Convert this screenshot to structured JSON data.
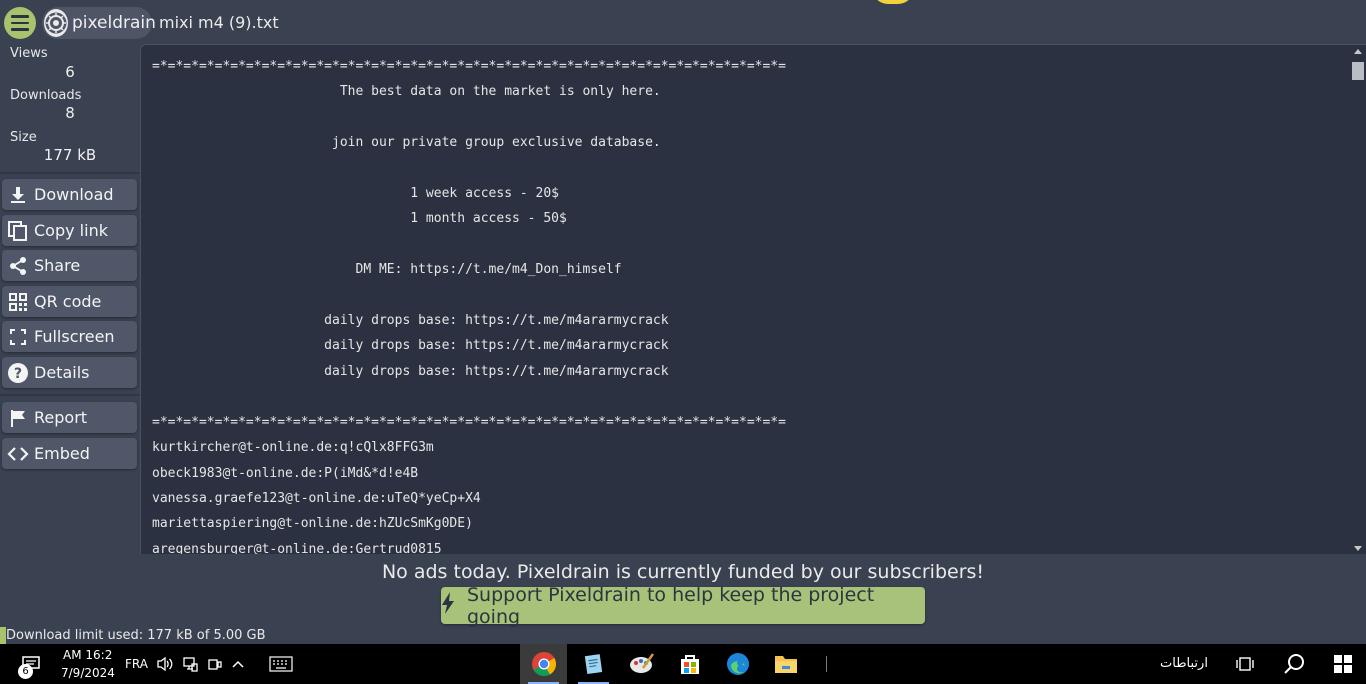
{
  "header": {
    "brand": "pixeldrain",
    "file_name": "mixi m4 (9).txt"
  },
  "stats": {
    "views_label": "Views",
    "views_value": "6",
    "downloads_label": "Downloads",
    "downloads_value": "8",
    "size_label": "Size",
    "size_value": "177 kB"
  },
  "sidebar": {
    "download": "Download",
    "copy_link": "Copy link",
    "share": "Share",
    "qr_code": "QR code",
    "fullscreen": "Fullscreen",
    "details": "Details",
    "report": "Report",
    "embed": "Embed"
  },
  "file_content": "=*=*=*=*=*=*=*=*=*=*=*=*=*=*=*=*=*=*=*=*=*=*=*=*=*=*=*=*=*=*=*=*=*=*=*=*=*=*=*=*=\n                        The best data on the market is only here.\n\n                       join our private group exclusive database.\n\n                                 1 week access - 20$\n                                 1 month access - 50$\n\n                          DM ME: https://t.me/m4_Don_himself\n\n                      daily drops base: https://t.me/m4ararmycrack\n                      daily drops base: https://t.me/m4ararmycrack\n                      daily drops base: https://t.me/m4ararmycrack\n\n=*=*=*=*=*=*=*=*=*=*=*=*=*=*=*=*=*=*=*=*=*=*=*=*=*=*=*=*=*=*=*=*=*=*=*=*=*=*=*=*=\nkurtkircher@t-online.de:q!cQlx8FFG3m\nobeck1983@t-online.de:P(iMd&*d!e4B\nvanessa.graefe123@t-online.de:uTeQ*yeCp+X4\nmariettaspiering@t-online.de:hZUcSmKg0DE)\naregensburger@t-online.de:Gertrud0815",
  "ad": {
    "message": "No ads today. Pixeldrain is currently funded by our subscribers!",
    "support_button": "Support Pixeldrain to help keep the project going"
  },
  "download_limit": "Download limit used: 177 kB of 5.00 GB",
  "taskbar": {
    "notification_count": "6",
    "time": "AM 16:2",
    "date": "7/9/2024",
    "language": "FRA",
    "connections": "ارتباطات"
  }
}
